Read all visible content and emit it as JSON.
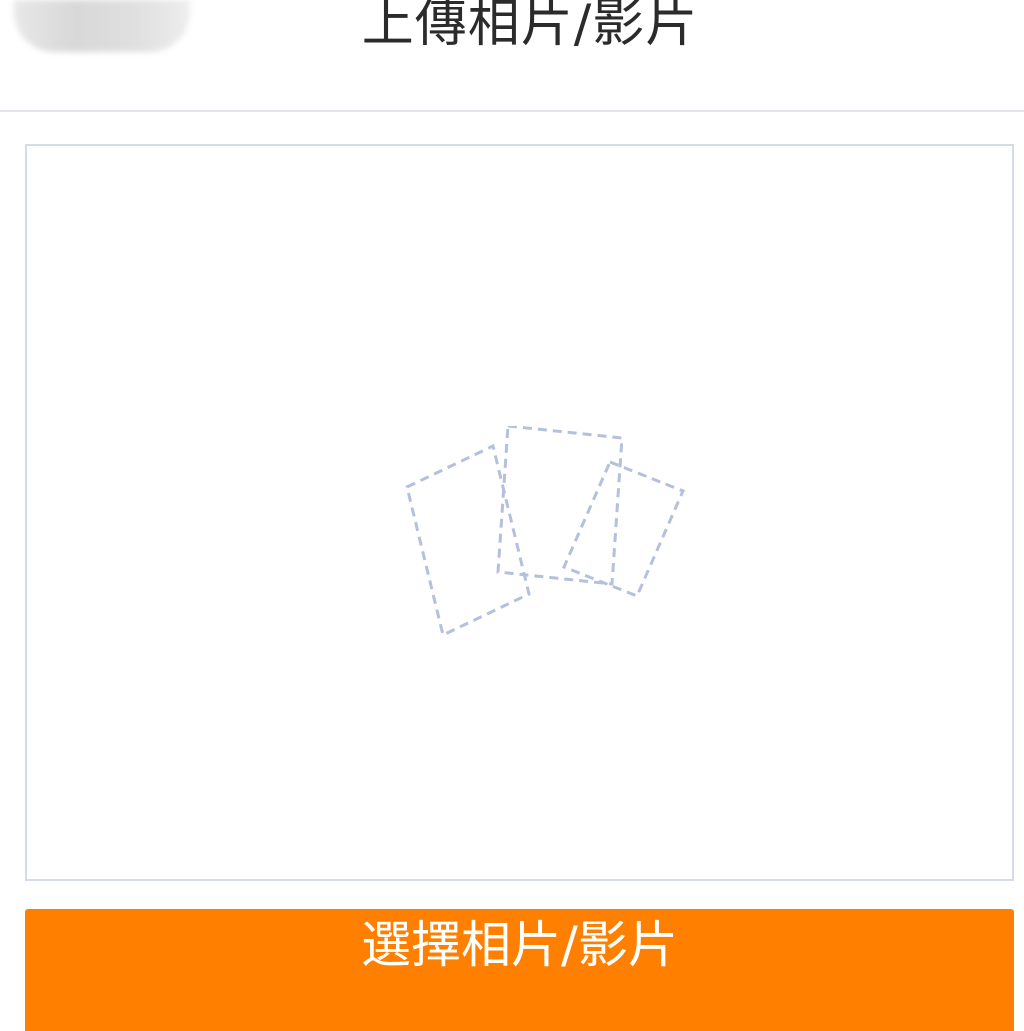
{
  "header": {
    "title": "上傳相片/影片",
    "back_icon": "back-icon"
  },
  "preview": {
    "icon": "camera-with-photos-icon",
    "icon_color": "#bcc7e1"
  },
  "actions": {
    "select_label": "選擇相片/影片",
    "accent_color": "#ff8000"
  }
}
